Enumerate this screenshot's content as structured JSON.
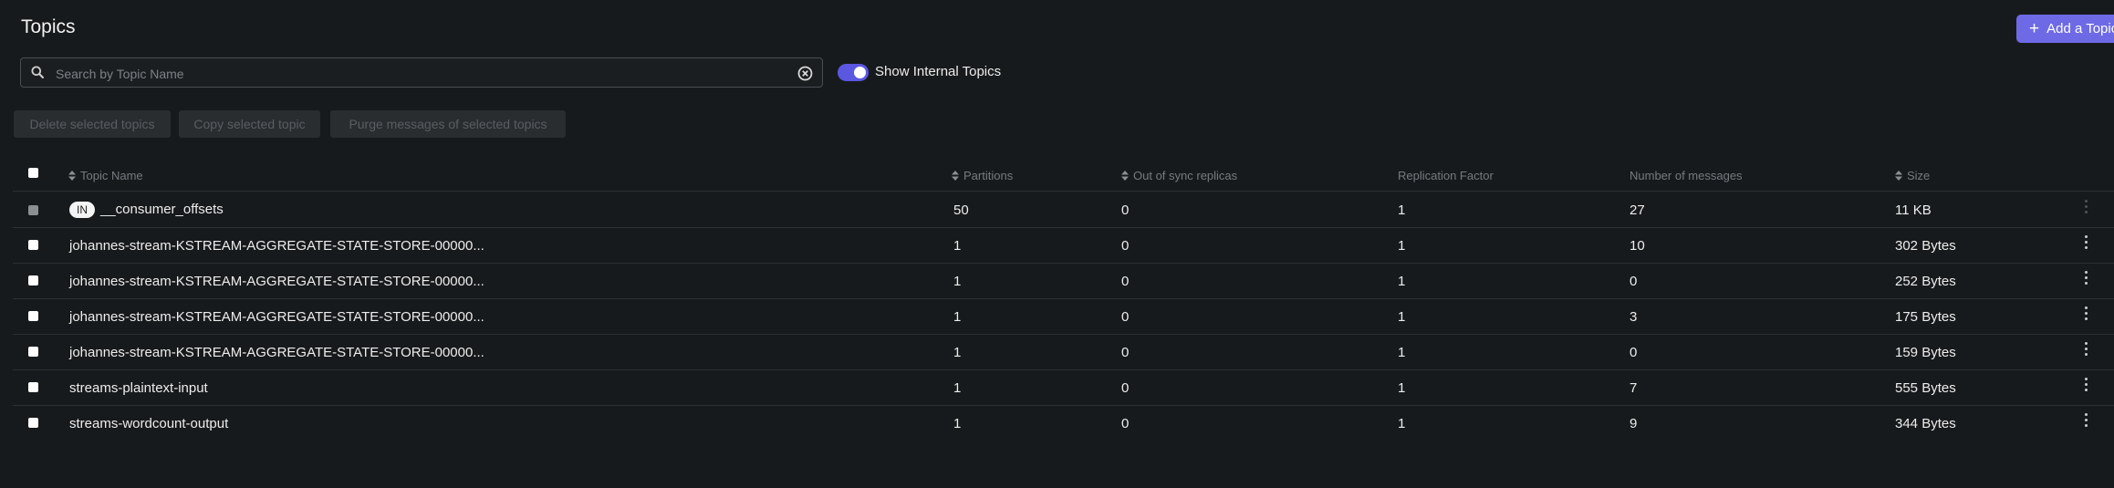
{
  "header": {
    "title": "Topics",
    "add_button_label": "Add a Topic"
  },
  "search": {
    "placeholder": "Search by Topic Name",
    "value": ""
  },
  "toggle": {
    "label": "Show Internal Topics",
    "checked": true
  },
  "bulk_actions": [
    "Delete selected topics",
    "Copy selected topic",
    "Purge messages of selected topics"
  ],
  "table": {
    "columns": [
      "Topic Name",
      "Partitions",
      "Out of sync replicas",
      "Replication Factor",
      "Number of messages",
      "Size"
    ],
    "rows": [
      {
        "internal_badge": "IN",
        "name": "__consumer_offsets",
        "partitions": "50",
        "out_of_sync": "0",
        "replication": "1",
        "messages": "27",
        "size": "11 KB"
      },
      {
        "internal_badge": "",
        "name": "johannes-stream-KSTREAM-AGGREGATE-STATE-STORE-00000...",
        "partitions": "1",
        "out_of_sync": "0",
        "replication": "1",
        "messages": "10",
        "size": "302 Bytes"
      },
      {
        "internal_badge": "",
        "name": "johannes-stream-KSTREAM-AGGREGATE-STATE-STORE-00000...",
        "partitions": "1",
        "out_of_sync": "0",
        "replication": "1",
        "messages": "0",
        "size": "252 Bytes"
      },
      {
        "internal_badge": "",
        "name": "johannes-stream-KSTREAM-AGGREGATE-STATE-STORE-00000...",
        "partitions": "1",
        "out_of_sync": "0",
        "replication": "1",
        "messages": "3",
        "size": "175 Bytes"
      },
      {
        "internal_badge": "",
        "name": "johannes-stream-KSTREAM-AGGREGATE-STATE-STORE-00000...",
        "partitions": "1",
        "out_of_sync": "0",
        "replication": "1",
        "messages": "0",
        "size": "159 Bytes"
      },
      {
        "internal_badge": "",
        "name": "streams-plaintext-input",
        "partitions": "1",
        "out_of_sync": "0",
        "replication": "1",
        "messages": "7",
        "size": "555 Bytes"
      },
      {
        "internal_badge": "",
        "name": "streams-wordcount-output",
        "partitions": "1",
        "out_of_sync": "0",
        "replication": "1",
        "messages": "9",
        "size": "344 Bytes"
      }
    ]
  },
  "colors": {
    "accent": "#6e6ae6",
    "background": "#171a1c"
  }
}
